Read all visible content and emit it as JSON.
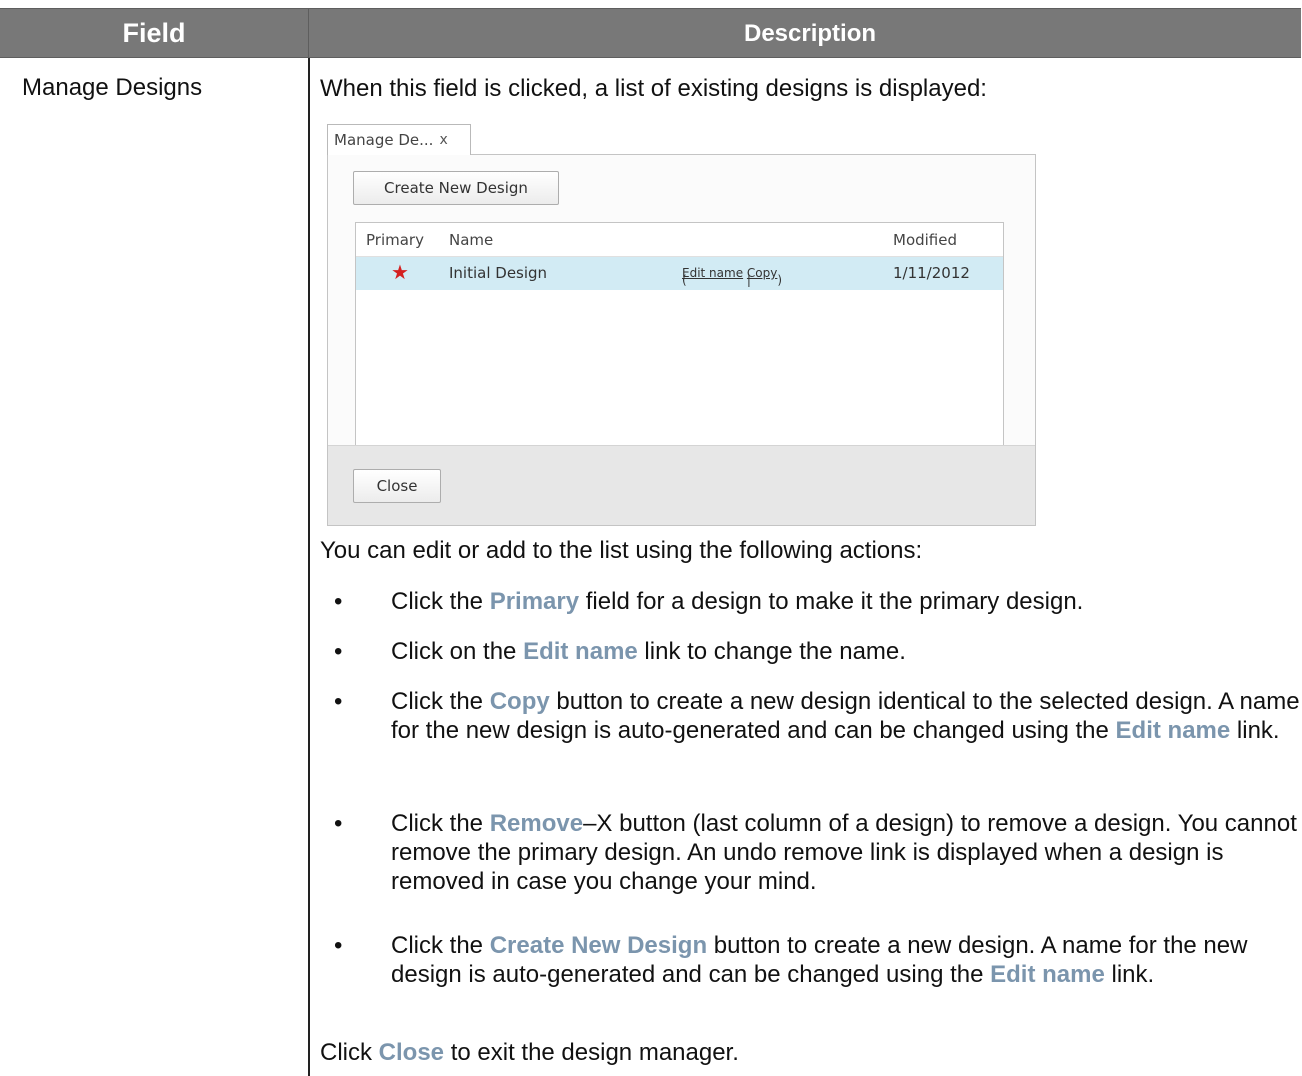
{
  "table": {
    "header_field": "Field",
    "header_description": "Description",
    "field_name": "Manage Designs"
  },
  "intro": "When this field is clicked, a list of existing designs is displayed:",
  "screenshot": {
    "tab_label": "Manage De...",
    "tab_close": "x",
    "create_button": "Create New Design",
    "columns": {
      "primary": "Primary",
      "name": "Name",
      "modified": "Modified"
    },
    "row": {
      "primary_marker": "★",
      "name": "Initial Design",
      "open_paren": "(",
      "edit_name_link": "Edit name",
      "separator": "|",
      "copy_link": "Copy",
      "close_paren": ")",
      "modified": "1/11/2012"
    },
    "close_button": "Close"
  },
  "actions_intro": "You can edit or add to the list using the following actions:",
  "bullets": [
    {
      "pre": "Click the ",
      "kw": "Primary",
      "post": " field for a design to make it the primary design."
    },
    {
      "pre": "Click on the ",
      "kw": "Edit name",
      "post": " link to change the name."
    },
    {
      "pre": "Click the ",
      "kw": "Copy",
      "post": " button to create a new design identical to the selected design. A name for the new design is auto-generated and can be changed using the ",
      "kw2": "Edit name",
      "post2": " link."
    },
    {
      "pre": "Click the ",
      "kw": "Remove",
      "post": "–X button (last column of a design) to remove a design. You cannot remove the primary design. An undo remove link is displayed when a design is removed in case you change your mind."
    },
    {
      "pre": "Click the ",
      "kw": "Create New Design",
      "post": " button to create a new design. A name for the new design is auto-generated and can be changed using the ",
      "kw2": "Edit name",
      "post2": " link."
    }
  ],
  "closing": {
    "pre": "Click ",
    "kw": "Close",
    "post": " to exit the design manager."
  },
  "colors": {
    "header_bg": "#787878",
    "keyword": "#7b95ad",
    "selected_row": "#d2ebf4",
    "star": "#d42020"
  }
}
